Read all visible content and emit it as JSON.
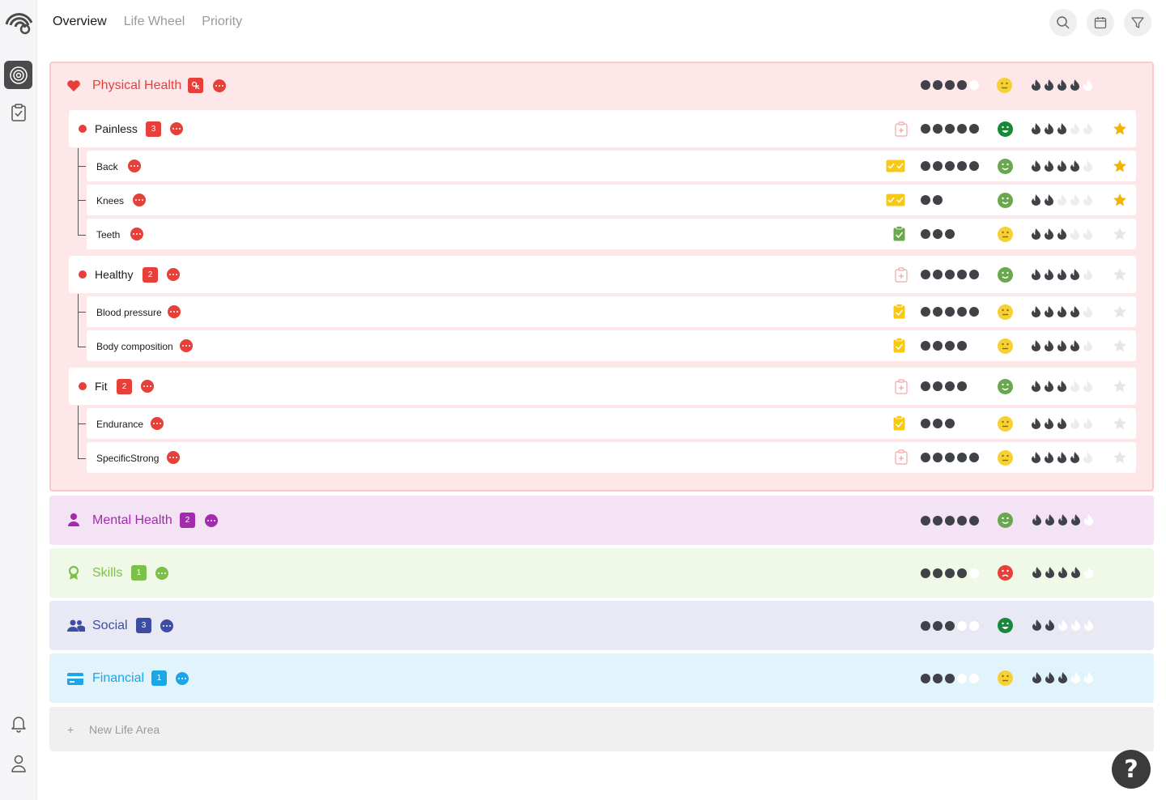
{
  "nav": {
    "tabs": [
      {
        "label": "Overview",
        "active": true
      },
      {
        "label": "Life Wheel",
        "active": false
      },
      {
        "label": "Priority",
        "active": false
      }
    ]
  },
  "sidebar": {
    "icons": [
      "logo-icon",
      "goals-target-icon",
      "tasks-clipboard-icon",
      "bell-icon",
      "user-icon"
    ]
  },
  "actions": {
    "icons": [
      "search-icon",
      "calendar-icon",
      "filter-icon"
    ]
  },
  "colors": {
    "physical": "#e7403a",
    "mental": "#a329ae",
    "skills": "#7cc04a",
    "social": "#3d4da3",
    "financial": "#1aa6e7",
    "progress": "#3f4247",
    "star_on": "#f1b400",
    "face_yellow": "#f7d133",
    "face_green": "#6aa84f",
    "face_dark_green": "#168a3a",
    "face_red": "#e7403a"
  },
  "areas": {
    "physical": {
      "title": "Physical Health",
      "badge": "",
      "progress": 4,
      "mood": "neutral",
      "effort": 4,
      "groups": {
        "painless": {
          "title": "Painless",
          "badge": "3",
          "progress": 5,
          "mood": "very-happy",
          "effort": 3,
          "starred": true,
          "items": [
            {
              "title": "Back",
              "progress": 5,
              "mood": "happy",
              "effort": 4,
              "starred": true
            },
            {
              "title": "Knees",
              "progress": 2,
              "mood": "happy",
              "effort": 2,
              "starred": true
            },
            {
              "title": "Teeth",
              "progress": 3,
              "mood": "neutral",
              "effort": 3,
              "starred": false
            }
          ]
        },
        "healthy": {
          "title": "Healthy",
          "badge": "2",
          "progress": 5,
          "mood": "happy",
          "effort": 4,
          "starred": false,
          "items": [
            {
              "title": "Blood pressure",
              "progress": 5,
              "mood": "neutral",
              "effort": 4,
              "starred": false
            },
            {
              "title": "Body composition",
              "progress": 4,
              "mood": "neutral",
              "effort": 4,
              "starred": false
            }
          ]
        },
        "fit": {
          "title": "Fit",
          "badge": "2",
          "progress": 4,
          "mood": "happy",
          "effort": 3,
          "starred": false,
          "items": [
            {
              "title": "Endurance",
              "progress": 3,
              "mood": "neutral",
              "effort": 3,
              "starred": false
            },
            {
              "title": "SpecificStrong",
              "progress": 5,
              "mood": "neutral",
              "effort": 4,
              "starred": false
            }
          ]
        }
      }
    },
    "mental": {
      "title": "Mental Health",
      "badge": "2",
      "progress": 5,
      "mood": "happy",
      "effort": 4
    },
    "skills": {
      "title": "Skills",
      "badge": "1",
      "progress": 4,
      "mood": "sad",
      "effort": 4
    },
    "social": {
      "title": "Social",
      "badge": "3",
      "progress": 3,
      "mood": "very-happy",
      "effort": 2
    },
    "financial": {
      "title": "Financial",
      "badge": "1",
      "progress": 3,
      "mood": "neutral",
      "effort": 3
    }
  },
  "new_area": {
    "plus": "+",
    "label": "New Life Area"
  },
  "help": {
    "label": "?"
  }
}
